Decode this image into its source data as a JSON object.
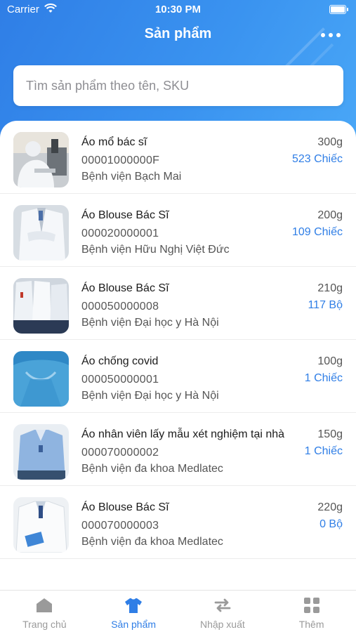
{
  "status": {
    "carrier": "Carrier",
    "time": "10:30 PM"
  },
  "nav": {
    "title": "Sản phẩm"
  },
  "search": {
    "placeholder": "Tìm sản phẩm theo tên, SKU"
  },
  "products": [
    {
      "name": "Áo mổ bác sĩ",
      "sku": "00001000000F",
      "org": "Bệnh viện Bạch Mai",
      "weight": "300g",
      "qty": "523 Chiếc"
    },
    {
      "name": "Áo Blouse Bác Sĩ",
      "sku": "000020000001",
      "org": "Bệnh viện Hữu Nghị Việt Đức",
      "weight": "200g",
      "qty": "109 Chiếc"
    },
    {
      "name": "Áo Blouse Bác Sĩ",
      "sku": "000050000008",
      "org": "Bệnh viện Đại học y Hà Nội",
      "weight": "210g",
      "qty": "117 Bộ"
    },
    {
      "name": "Áo chống covid",
      "sku": "000050000001",
      "org": "Bệnh viện Đại học y Hà Nội",
      "weight": "100g",
      "qty": "1 Chiếc"
    },
    {
      "name": "Áo nhân viên lấy mẫu xét nghiệm tại nhà",
      "sku": "000070000002",
      "org": "Bệnh viện đa khoa Medlatec",
      "weight": "150g",
      "qty": "1 Chiếc"
    },
    {
      "name": "Áo Blouse Bác Sĩ",
      "sku": "000070000003",
      "org": "Bệnh viện đa khoa Medlatec",
      "weight": "220g",
      "qty": "0 Bộ"
    }
  ],
  "tabs": [
    {
      "label": "Trang chủ",
      "icon": "home-icon"
    },
    {
      "label": "Sản phẩm",
      "icon": "shirt-icon"
    },
    {
      "label": "Nhập xuất",
      "icon": "transfer-icon"
    },
    {
      "label": "Thêm",
      "icon": "grid-icon"
    }
  ],
  "colors": {
    "accent": "#2f7ee6",
    "header_gradient_start": "#2f7ee6",
    "header_gradient_end": "#4aa8f7"
  }
}
